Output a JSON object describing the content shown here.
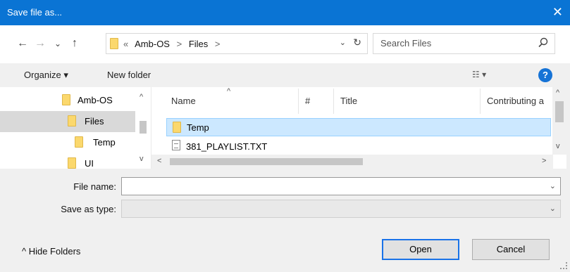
{
  "window": {
    "title": "Save file as...",
    "close_glyph": "✕"
  },
  "nav": {
    "back_glyph": "←",
    "forward_glyph": "→",
    "recent_glyph": "⌄",
    "up_glyph": "↑"
  },
  "address": {
    "chevrons": "«",
    "crumbs": [
      "Amb-OS",
      "Files"
    ],
    "separator": ">",
    "dropdown_glyph": "⌄",
    "refresh_glyph": "↻"
  },
  "search": {
    "placeholder": "Search Files"
  },
  "toolbar": {
    "organize_label": "Organize ▾",
    "new_folder_label": "New folder",
    "view_glyph": "☷ ▾",
    "help_glyph": "?"
  },
  "sidebar": {
    "items": [
      {
        "label": "Amb-OS",
        "selected": false
      },
      {
        "label": "Files",
        "selected": true
      },
      {
        "label": "Temp",
        "selected": false
      },
      {
        "label": "UI",
        "selected": false
      }
    ],
    "scroll_up": "^",
    "scroll_down": "v"
  },
  "columns": [
    "Name",
    "#",
    "Title",
    "Contributing a"
  ],
  "sort_indicator": "^",
  "files": [
    {
      "name": "Temp",
      "type": "folder",
      "selected": true
    },
    {
      "name": "381_PLAYLIST.TXT",
      "type": "text",
      "selected": false
    }
  ],
  "scroll": {
    "up": "^",
    "down": "v",
    "left": "<",
    "right": ">"
  },
  "form": {
    "file_name_label": "File name:",
    "file_name_value": "",
    "save_type_label": "Save as type:",
    "save_type_value": "",
    "chevron": "⌄"
  },
  "footer": {
    "hide_folders_label": "^  Hide Folders",
    "open_label": "Open",
    "cancel_label": "Cancel"
  },
  "colors": {
    "titlebar": "#0a74d4",
    "selection": "#cce8ff",
    "folder": "#fbd86d",
    "accent": "#1a73e8"
  }
}
